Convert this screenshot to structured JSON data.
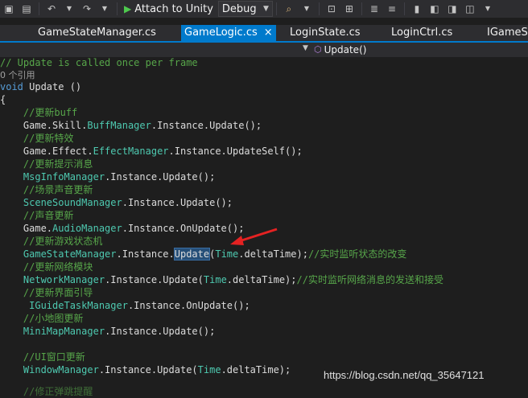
{
  "toolbar": {
    "attach_label": "Attach to Unity",
    "config_value": "Debug"
  },
  "tabs": [
    {
      "label": "GameStateManager.cs",
      "active": false
    },
    {
      "label": "GameLogic.cs",
      "active": true,
      "close": "×"
    },
    {
      "label": "LoginState.cs",
      "active": false
    },
    {
      "label": "LoginCtrl.cs",
      "active": false
    },
    {
      "label": "IGameSta",
      "active": false
    }
  ],
  "navbar": {
    "member": "Update()"
  },
  "code": {
    "comment_update": "// Update is called once per frame",
    "refs": "0 个引用",
    "kw_void": "void",
    "fn_update": " Update ()",
    "brace_open": "{",
    "c1": "//更新buff",
    "c2": "//更新特效",
    "c3": "//更新提示消息",
    "c4": "//场景声音更新",
    "c5": "//声音更新",
    "c6": "//更新游戏状态机",
    "c7": "//更新网络模块",
    "c8": "//更新界面引导",
    "c9": "//小地图更新",
    "c10": "//UI窗口更新",
    "c6_tail": "//实时监听状态的改变",
    "c7_tail": "//实时监听网络消息的发送和接受",
    "c11": "//修正弹跳提醒"
  },
  "watermark": "https://blog.csdn.net/qq_35647121",
  "colors": {
    "background": "#1e1e1e",
    "accent": "#007acc",
    "comment": "#57a64a",
    "keyword": "#569cd6",
    "type": "#4ec9b0",
    "arrow": "#e52222"
  }
}
